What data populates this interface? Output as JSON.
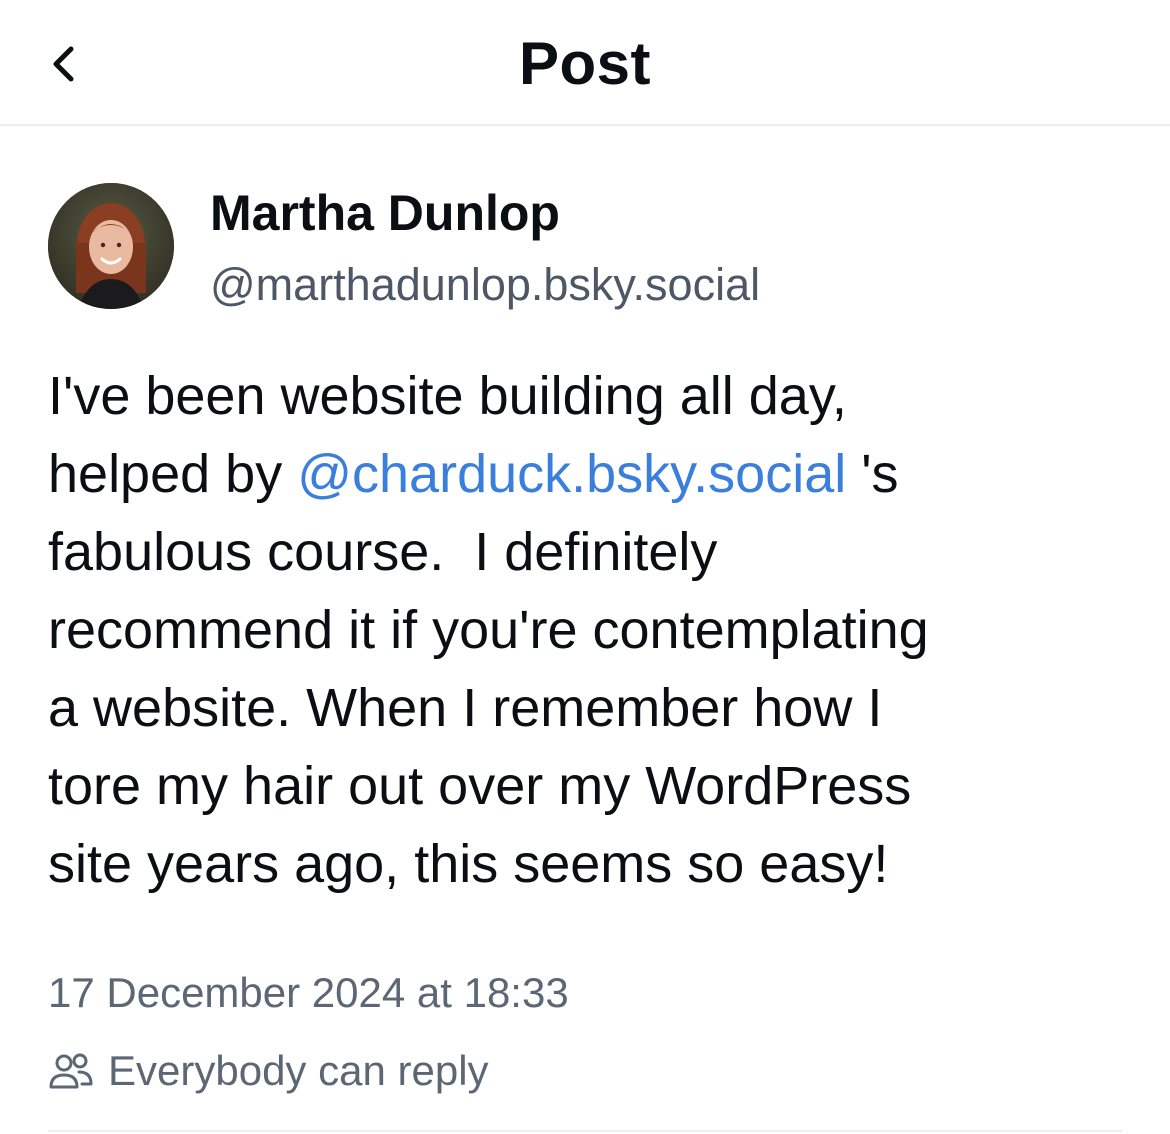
{
  "header": {
    "title": "Post",
    "back_icon": "chevron-left-icon"
  },
  "author": {
    "name": "Martha Dunlop",
    "handle": "@marthadunlop.bsky.social",
    "avatar_icon": "avatar"
  },
  "post": {
    "line1": "I've been website building all day,",
    "line2_before": "helped by ",
    "mention": "@charduck.bsky.social",
    "line2_after": " 's",
    "line3": "fabulous course.  I definitely",
    "line4": "recommend it if you're contemplating",
    "line5": "a website. When I remember how I",
    "line6": "tore my hair out over my WordPress",
    "line7": "site years ago, this seems so easy!"
  },
  "meta": {
    "timestamp": "17 December 2024 at 18:33",
    "reply_setting": "Everybody can reply",
    "reply_icon": "people-icon"
  },
  "colors": {
    "mention": "#3a7fdc",
    "secondary_text": "#5b6775",
    "divider": "#e9edf1"
  }
}
